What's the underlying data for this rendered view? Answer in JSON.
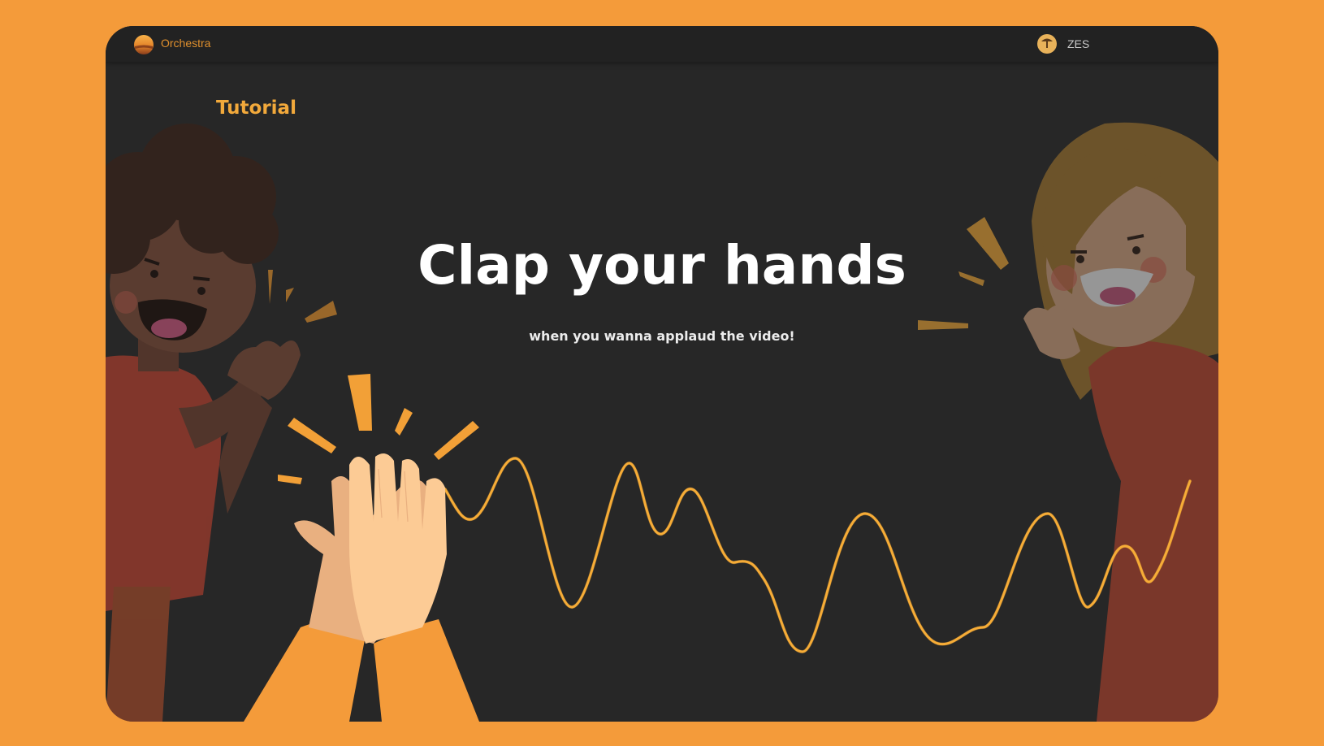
{
  "app": {
    "name": "Orchestra",
    "logo_icon": "sunset-logo-icon"
  },
  "user": {
    "name": "ZES",
    "avatar_icon": "user-avatar"
  },
  "tutorial": {
    "section_label": "Tutorial",
    "headline": "Clap your hands",
    "subline": "when you wanna applaud the video!",
    "illustrations": [
      "clapping-person-left-icon",
      "clapping-hands-icon",
      "clapping-person-right-icon",
      "sound-wave-icon"
    ]
  },
  "colors": {
    "page_background": "#F49B3A",
    "window_background": "#272727",
    "accent": "#F2A93B",
    "wave": "#F6AC37"
  }
}
